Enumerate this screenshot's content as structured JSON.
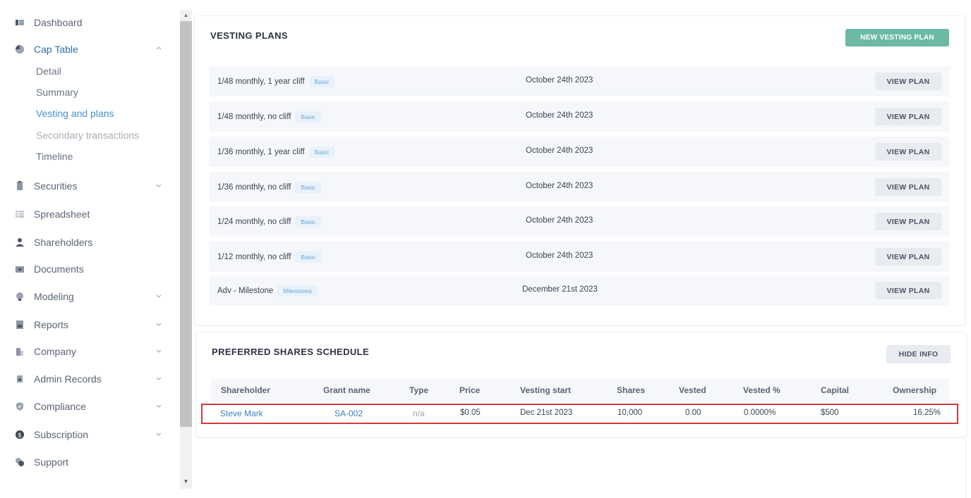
{
  "sidebar": {
    "items": [
      {
        "label": "Dashboard",
        "icon": "dashboard-icon"
      },
      {
        "label": "Cap Table",
        "icon": "pie-chart-icon"
      },
      {
        "label": "Securities",
        "icon": "clipboard-icon"
      },
      {
        "label": "Spreadsheet",
        "icon": "grid-icon"
      },
      {
        "label": "Shareholders",
        "icon": "person-icon"
      },
      {
        "label": "Documents",
        "icon": "folder-icon"
      },
      {
        "label": "Modeling",
        "icon": "lightbulb-icon"
      },
      {
        "label": "Reports",
        "icon": "report-icon"
      },
      {
        "label": "Company",
        "icon": "building-icon"
      },
      {
        "label": "Admin Records",
        "icon": "records-icon"
      },
      {
        "label": "Compliance",
        "icon": "shield-icon"
      },
      {
        "label": "Subscription",
        "icon": "dollar-icon"
      },
      {
        "label": "Support",
        "icon": "support-icon"
      }
    ],
    "cap_table_sub": [
      "Detail",
      "Summary",
      "Vesting and plans",
      "Secondary transactions",
      "Timeline"
    ]
  },
  "vesting": {
    "title": "VESTING PLANS",
    "new_button": "NEW VESTING PLAN",
    "view_label": "VIEW PLAN",
    "plans": [
      {
        "name": "1/48 monthly, 1 year cliff",
        "badge": "Basic",
        "date": "October 24th 2023"
      },
      {
        "name": "1/48 monthly, no cliff",
        "badge": "Basic",
        "date": "October 24th 2023"
      },
      {
        "name": "1/36 monthly, 1 year cliff",
        "badge": "Basic",
        "date": "October 24th 2023"
      },
      {
        "name": "1/36 monthly, no cliff",
        "badge": "Basic",
        "date": "October 24th 2023"
      },
      {
        "name": "1/24 monthly, no cliff",
        "badge": "Basic",
        "date": "October 24th 2023"
      },
      {
        "name": "1/12 monthly, no cliff",
        "badge": "Basic",
        "date": "October 24th 2023"
      },
      {
        "name": "Adv - Milestone",
        "badge": "Milestones",
        "date": "December 21st 2023"
      }
    ]
  },
  "preferred": {
    "title": "PREFERRED SHARES SCHEDULE",
    "hide_button": "HIDE INFO",
    "columns": [
      "Shareholder",
      "Grant name",
      "Type",
      "Price",
      "Vesting start",
      "Shares",
      "Vested",
      "Vested %",
      "Capital",
      "Ownership"
    ],
    "row": {
      "shareholder": "Steve Mark",
      "grant": "SA-002",
      "type": "n/a",
      "price": "$0.05",
      "vesting_start": "Dec 21st 2023",
      "shares": "10,000",
      "vested": "0.00",
      "vested_pct": "0.0000%",
      "capital": "$500",
      "ownership": "16.25%"
    }
  },
  "colors": {
    "accent_green": "#6cbaa5",
    "link_blue": "#3b7fc0",
    "active_sub": "#4a8fc9",
    "highlight_red": "#d33a3a"
  }
}
